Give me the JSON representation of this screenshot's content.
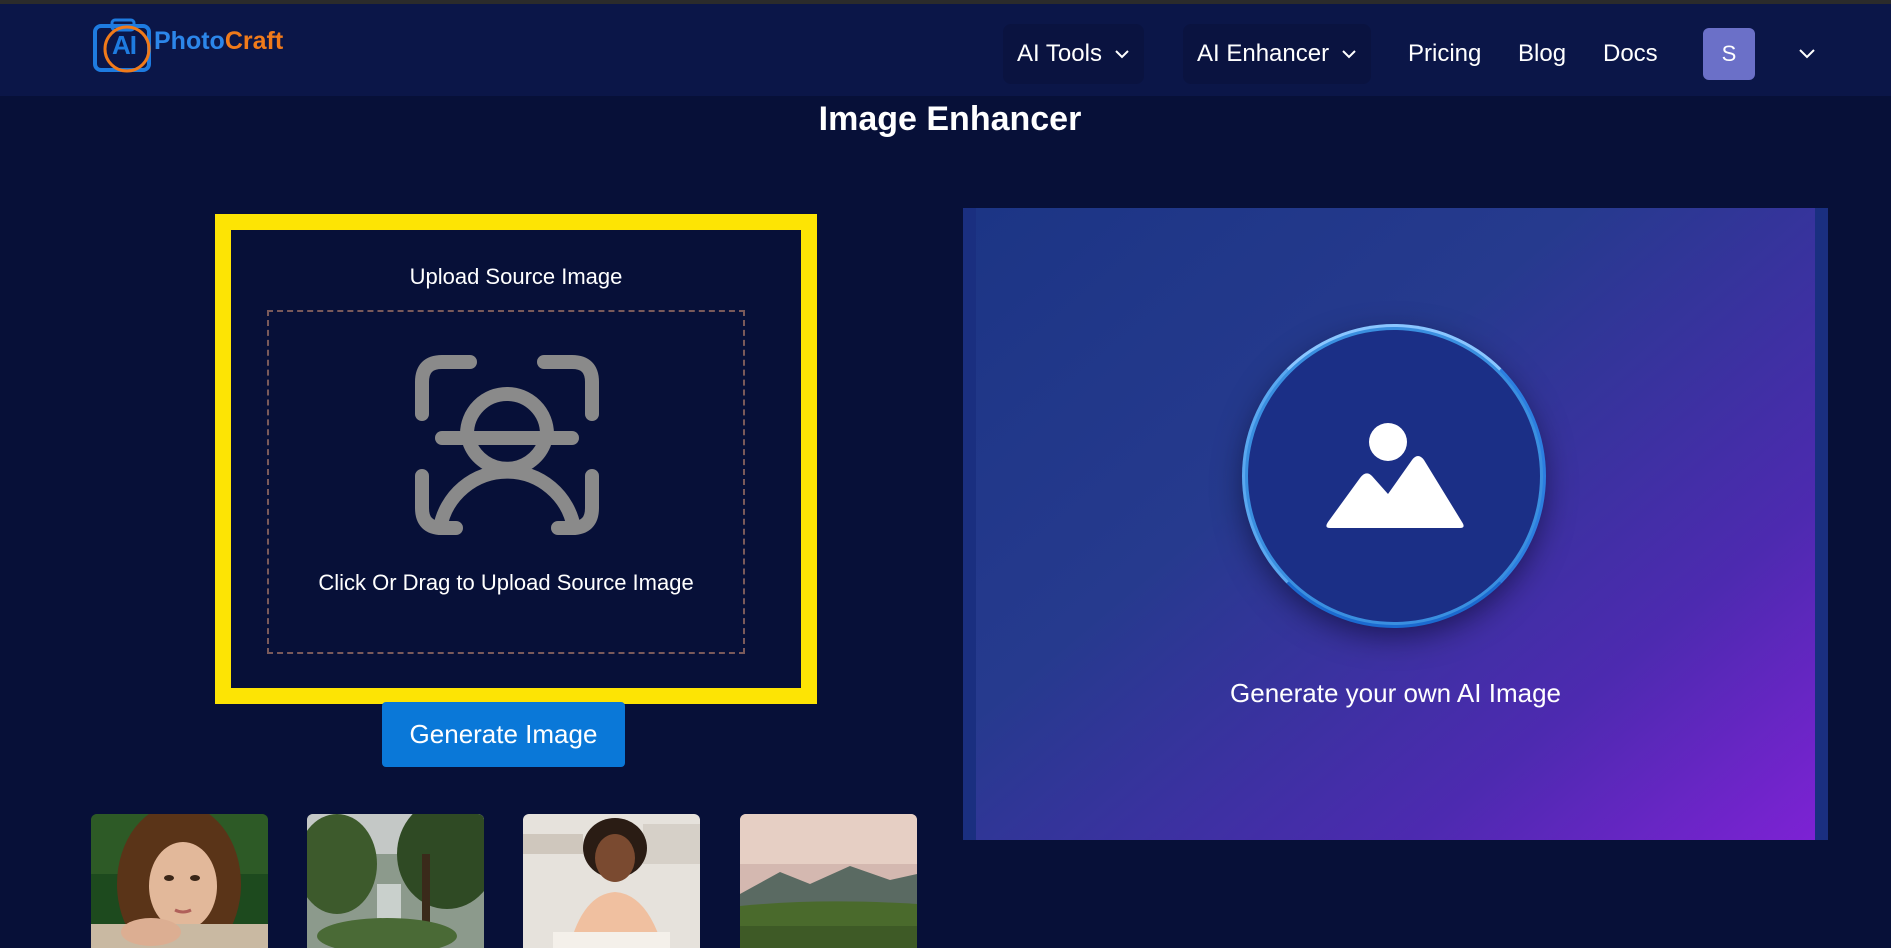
{
  "header": {
    "logo": {
      "mark_text": "AI",
      "name_part1": "Photo",
      "name_part2": "Craft"
    },
    "nav": {
      "ai_tools": "AI Tools",
      "ai_enhancer": "AI Enhancer",
      "pricing": "Pricing",
      "blog": "Blog",
      "docs": "Docs"
    },
    "avatar_initial": "S"
  },
  "main": {
    "title": "Image Enhancer",
    "upload": {
      "label": "Upload Source Image",
      "drop_text": "Click Or Drag to Upload Source Image",
      "icon": "face-scan-icon"
    },
    "generate_button": "Generate Image",
    "thumbnails": [
      {
        "name": "sample-thumbnail-woman-portrait"
      },
      {
        "name": "sample-thumbnail-forest"
      },
      {
        "name": "sample-thumbnail-woman-at-table"
      },
      {
        "name": "sample-thumbnail-landscape"
      }
    ],
    "result": {
      "icon": "image-icon",
      "text": "Generate your own AI Image"
    }
  },
  "colors": {
    "background": "#071038",
    "header": "#0b1648",
    "highlight_border": "#fde404",
    "button": "#0a78d8",
    "avatar": "#6b70c8"
  }
}
